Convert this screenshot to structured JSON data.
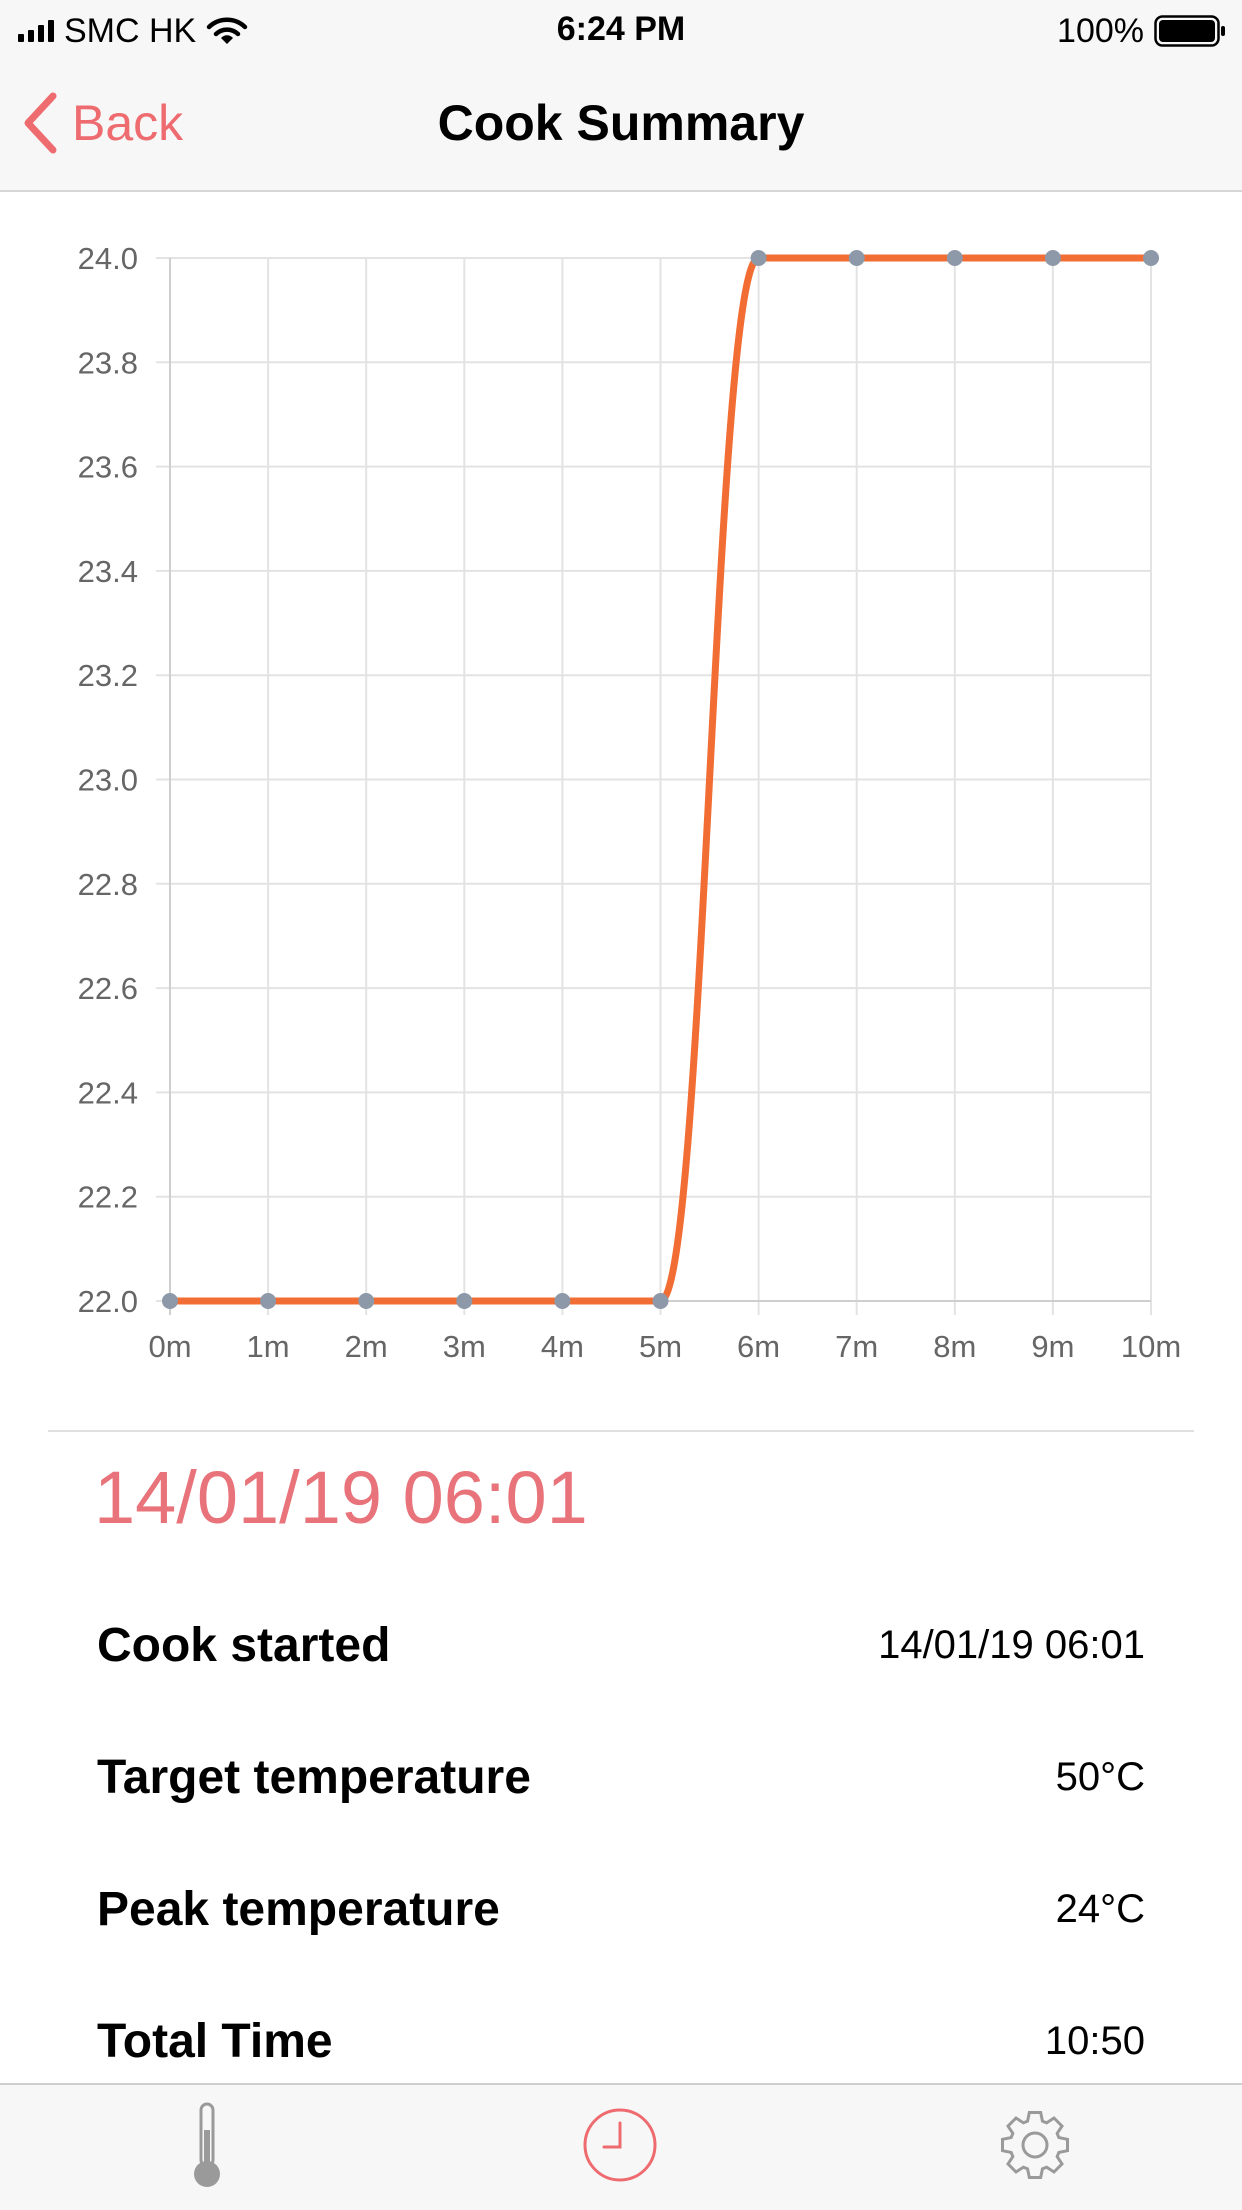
{
  "status_bar": {
    "carrier": "SMC HK",
    "time": "6:24 PM",
    "battery": "100%"
  },
  "nav": {
    "back_label": "Back",
    "title": "Cook Summary",
    "accent_color": "#ee6b6f"
  },
  "chart_data": {
    "type": "line",
    "x": [
      "0m",
      "1m",
      "2m",
      "3m",
      "4m",
      "5m",
      "6m",
      "7m",
      "8m",
      "9m",
      "10m"
    ],
    "series": [
      {
        "values": [
          22.0,
          22.0,
          22.0,
          22.0,
          22.0,
          22.0,
          24.0,
          24.0,
          24.0,
          24.0,
          24.0
        ],
        "color": "#f26d34"
      }
    ],
    "yticks": [
      "22.0",
      "22.2",
      "22.4",
      "22.6",
      "22.8",
      "23.0",
      "23.2",
      "23.4",
      "23.6",
      "23.8",
      "24.0"
    ],
    "ylim": [
      22.0,
      24.0
    ],
    "grid": true,
    "point_color": "#8d98a8"
  },
  "summary": {
    "date_heading": "14/01/19 06:01",
    "rows": [
      {
        "label": "Cook started",
        "value": "14/01/19 06:01"
      },
      {
        "label": "Target temperature",
        "value": "50°C"
      },
      {
        "label": "Peak temperature",
        "value": "24°C"
      },
      {
        "label": "Total Time",
        "value": "10:50"
      }
    ]
  },
  "tab_bar": {
    "tabs": [
      {
        "icon": "thermometer-icon"
      },
      {
        "icon": "clock-icon",
        "active": true
      },
      {
        "icon": "gear-icon"
      }
    ]
  }
}
